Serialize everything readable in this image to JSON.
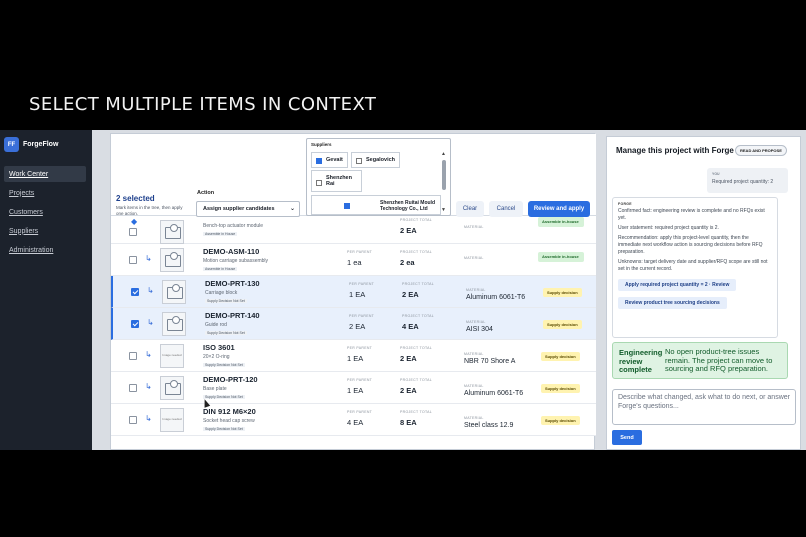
{
  "headline": "SELECT MULTIPLE ITEMS IN CONTEXT",
  "brand": {
    "logo": "FF",
    "name": "ForgeFlow"
  },
  "nav": [
    "Work Center",
    "Projects",
    "Customers",
    "Suppliers",
    "Administration"
  ],
  "selection": {
    "count": "2 selected",
    "help": "Mark items in the tree, then apply one action.",
    "action_label": "Action",
    "action_value": "Assign supplier candidates",
    "suppliers_label": "Suppliers",
    "supplier_options": [
      {
        "name": "Gevait",
        "checked": true
      },
      {
        "name": "Segalovich",
        "checked": false
      },
      {
        "name": "Shenzhen Rai",
        "checked": false
      },
      {
        "name": "Shenzhen Ruitai Mould Technology Co., Ltd",
        "checked": true
      }
    ],
    "clear_label": "Clear",
    "cancel_label": "Cancel",
    "apply_label": "Review and apply"
  },
  "labels": {
    "per_parent": "PER PARENT",
    "project_total": "PROJECT TOTAL",
    "material": "MATERIAL",
    "image_needed": "Image needed"
  },
  "rows": [
    {
      "name": "",
      "desc": "Bench-top actuator module",
      "tag": "Assemble in House",
      "per_parent": "",
      "project_total": "2 EA",
      "material": "",
      "badge": "Assemble in-house",
      "selected": false,
      "thumb": "img",
      "icon": "diamond"
    },
    {
      "name": "DEMO-ASM-110",
      "desc": "Motion carriage subassembly",
      "tag": "Assemble in House",
      "per_parent": "1 ea",
      "project_total": "2 ea",
      "material": "",
      "badge": "Assemble in-house",
      "selected": false,
      "thumb": "img",
      "icon": "branch"
    },
    {
      "name": "DEMO-PRT-130",
      "desc": "Carriage block",
      "tag": "Supply Decision Not Set",
      "per_parent": "1 EA",
      "project_total": "2 EA",
      "material": "Aluminum 6061-T6",
      "badge": "Supply decision",
      "selected": true,
      "thumb": "img",
      "icon": "branch"
    },
    {
      "name": "DEMO-PRT-140",
      "desc": "Guide rod",
      "tag": "Supply Decision Not Set",
      "per_parent": "2 EA",
      "project_total": "4 EA",
      "material": "AISI 304",
      "badge": "Supply decision",
      "selected": true,
      "thumb": "img",
      "icon": "branch"
    },
    {
      "name": "ISO 3601",
      "desc": "20×2 O-ring",
      "tag": "Supply Decision Not Set",
      "per_parent": "1 EA",
      "project_total": "2 EA",
      "material": "NBR 70 Shore A",
      "badge": "Supply decision",
      "selected": false,
      "thumb": "ph",
      "icon": "branch"
    },
    {
      "name": "DEMO-PRT-120",
      "desc": "Base plate",
      "tag": "Supply Decision Not Set",
      "per_parent": "1 EA",
      "project_total": "2 EA",
      "material": "Aluminum 6061-T6",
      "badge": "Supply decision",
      "selected": false,
      "thumb": "img",
      "icon": "branch"
    },
    {
      "name": "DIN 912 M6×20",
      "desc": "Socket head cap screw",
      "tag": "Supply Decision Not Set",
      "per_parent": "4 EA",
      "project_total": "8 EA",
      "material": "Steel class 12.9",
      "badge": "Supply decision",
      "selected": false,
      "thumb": "ph",
      "icon": "branch"
    }
  ],
  "panel": {
    "title": "Manage this project with Forge",
    "chip": "READ AND PROPOSE",
    "you_label": "YOU",
    "you_text": "Required project quantity: 2",
    "forge_label": "FORGE",
    "forge_paragraphs": [
      "Confirmed fact: engineering review is complete and no RFQs exist yet.",
      "User statement: required project quantity is 2.",
      "Recommendation: apply this project-level quantity, then the immediate next workflow action is sourcing decisions before RFQ preparation.",
      "Unknowns: target delivery date and supplier/RFQ scope are still not set in the current record."
    ],
    "forge_buttons": [
      "Apply required project quantity = 2 · Review",
      "Review product tree sourcing decisions"
    ],
    "done_title": "Engineering review complete",
    "done_text": "No open product-tree issues remain. The project can move to sourcing and RFQ preparation.",
    "input_placeholder": "Describe what changed, ask what to do next, or answer Forge's questions...",
    "send_label": "Send"
  }
}
